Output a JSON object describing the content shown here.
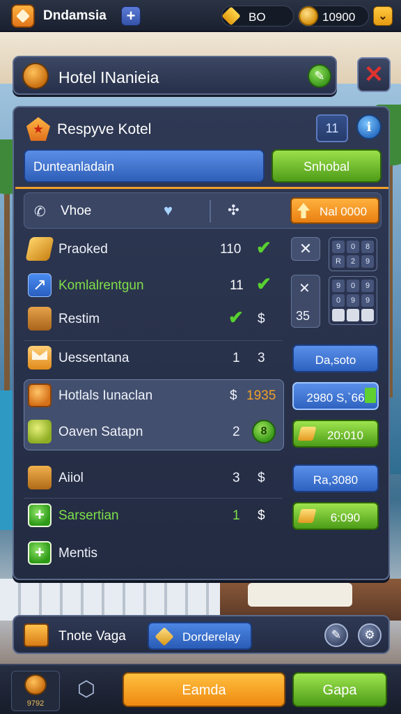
{
  "top_bar": {
    "player_name": "Dndamsia",
    "gems": "BO",
    "coins": "10900"
  },
  "hotel_bar": {
    "title": "Hotel INanieia"
  },
  "panel": {
    "title": "Respyve Kotel",
    "number": "11",
    "tab_blue": "Dunteanladain",
    "tab_green": "Snhobal",
    "filter": {
      "label": "Vhoe",
      "price": "Nal 0000"
    },
    "rows": [
      {
        "label": "Praoked",
        "num": "110",
        "color": "#ffffff"
      },
      {
        "label": "Komlalrentgun",
        "num": "11",
        "color": "#7fe04a"
      },
      {
        "label": "Restim",
        "num": "$",
        "color": "#ffffff"
      },
      {
        "label": "Uessentana",
        "num": "1",
        "num2": "3",
        "color": "#ffffff"
      },
      {
        "label": "Hotlals Iunaclan",
        "num": "$",
        "num2": "1935",
        "color": "#ffffff"
      },
      {
        "label": "Oaven Satapn",
        "num": "2",
        "badge": "8",
        "color": "#ffffff"
      },
      {
        "label": "Aiiol",
        "num": "3",
        "num2": "$",
        "color": "#ffffff"
      },
      {
        "label": "Sarsertian",
        "num": "1",
        "num2": "$",
        "color": "#7fe04a"
      },
      {
        "label": "Mentis",
        "color": "#ffffff"
      }
    ],
    "side_x_value": "35",
    "keypad_a": [
      "9",
      "0",
      "8",
      "R",
      "2",
      "9"
    ],
    "keypad_b": [
      "9",
      "0",
      "9",
      "0",
      "9",
      "9",
      "",
      "",
      ""
    ],
    "prices": {
      "p1": "Da,soto",
      "p2": "2980 S,`66",
      "p3": "20:010",
      "p4": "Ra,3080",
      "p5": "6:090"
    }
  },
  "mini_bar": {
    "label": "Tnote Vaga",
    "button": "Dorderelay"
  },
  "footer": {
    "badge_text": "9792",
    "orange_button": "Eamda",
    "green_button": "Gapa"
  },
  "colors": {
    "accent_orange": "#f0a02a",
    "accent_green": "#58d130",
    "accent_blue": "#2f5fb8",
    "close_red": "#e0322e"
  }
}
